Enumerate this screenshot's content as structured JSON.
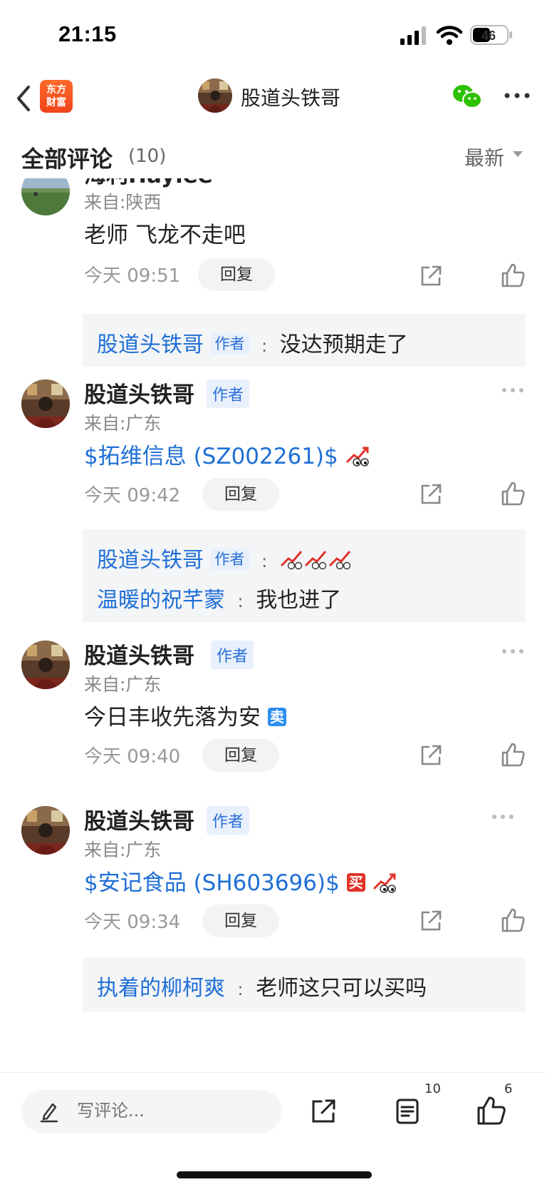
{
  "status": {
    "time": "21:15",
    "battery": "46"
  },
  "nav": {
    "logo_line1": "东方",
    "logo_line2": "财富",
    "title": "股道头铁哥"
  },
  "header": {
    "title": "全部评论",
    "count": "(10)",
    "sort": "最新"
  },
  "comments": [
    {
      "name": "海利Haylee",
      "from": "来自:陕西",
      "content": "老师 飞龙不走吧",
      "time": "今天 09:51",
      "reply": "回复",
      "replies": [
        {
          "name": "股道头铁哥",
          "tag": "作者",
          "colon": ":",
          "text": "没达预期走了"
        }
      ]
    },
    {
      "name": "股道头铁哥",
      "tag": "作者",
      "from": "来自:广东",
      "stock": "$拓维信息 (SZ002261)$",
      "time": "今天 09:42",
      "reply": "回复",
      "replies": [
        {
          "name": "股道头铁哥",
          "tag": "作者",
          "colon": ":"
        },
        {
          "name": "温暖的祝芊蒙",
          "colon": ":",
          "text": "我也进了"
        }
      ]
    },
    {
      "name": "股道头铁哥",
      "tag": "作者",
      "from": "来自:广东",
      "content": "今日丰收先落为安",
      "emoji": "卖",
      "time": "今天 09:40",
      "reply": "回复"
    },
    {
      "name": "股道头铁哥",
      "tag": "作者",
      "from": "来自:广东",
      "stock": "$安记食品 (SH603696)$",
      "emoji": "买",
      "time": "今天 09:34",
      "reply": "回复",
      "replies": [
        {
          "name": "执着的柳柯爽",
          "colon": ":",
          "text": "老师这只可以买吗"
        }
      ]
    }
  ],
  "bottom": {
    "input_placeholder": "写评论...",
    "comment_count": "10",
    "like_count": "6"
  },
  "colors": {
    "link": "#1e6fd6",
    "accent": "#f0441a",
    "wechat": "#2dc100"
  },
  "icons": [
    "back-icon",
    "wechat-icon",
    "more-icon",
    "share-icon",
    "like-icon",
    "edit-icon",
    "comment-list-icon",
    "stock-up-emoji-icon"
  ]
}
